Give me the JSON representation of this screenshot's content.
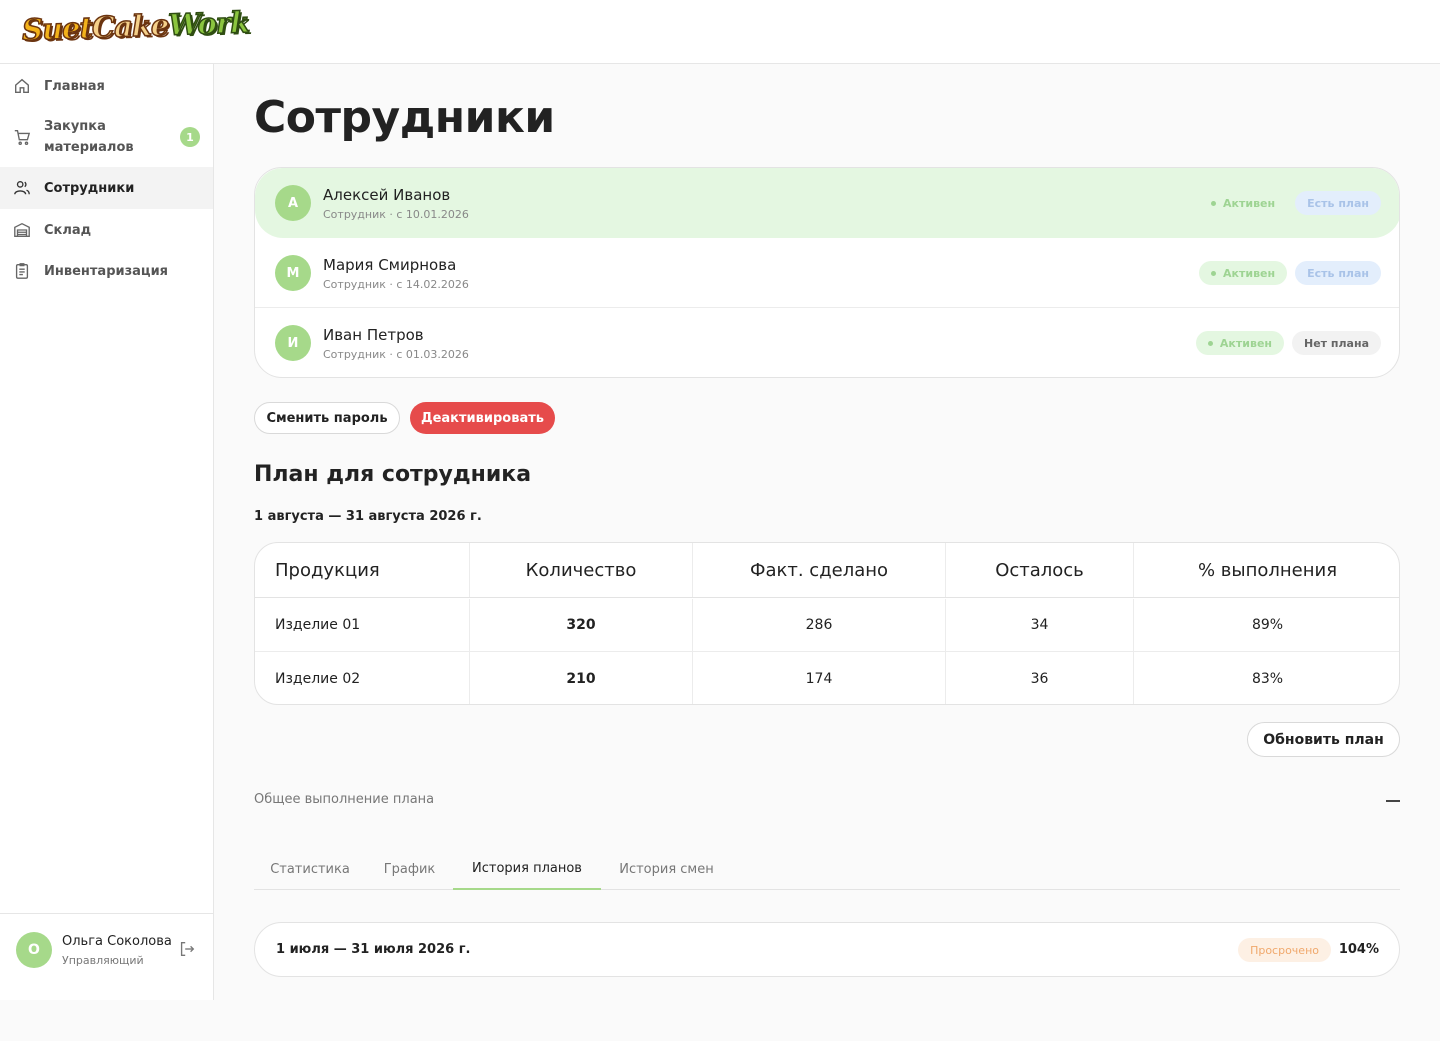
{
  "brand": {
    "logo_parts": [
      "Suet",
      "Cake",
      "Work"
    ]
  },
  "sidebar": {
    "items": [
      {
        "label": "Главная",
        "icon": "home-icon"
      },
      {
        "label": "Закупка материалов",
        "label_lines": [
          "Закупка",
          "материалов"
        ],
        "icon": "cart-icon",
        "badge": "1"
      },
      {
        "label": "Сотрудники",
        "icon": "users-icon",
        "active": true
      },
      {
        "label": "Склад",
        "icon": "warehouse-icon"
      },
      {
        "label": "Инвентаризация",
        "icon": "clipboard-icon"
      }
    ],
    "user": {
      "initial": "О",
      "name": "Ольга Соколова",
      "role": "Управляющий",
      "logout_icon": "logout-icon"
    }
  },
  "page": {
    "title": "Сотрудники"
  },
  "employees": [
    {
      "initial": "А",
      "name": "Алексей Иванов",
      "subtitle": "Сотрудник · с 10.01.2026",
      "status": "Активен",
      "plan": "Есть план",
      "selected": true
    },
    {
      "initial": "М",
      "name": "Мария Смирнова",
      "subtitle": "Сотрудник · с 14.02.2026",
      "status": "Активен",
      "plan": "Есть план"
    },
    {
      "initial": "И",
      "name": "Иван Петров",
      "subtitle": "Сотрудник · с 01.03.2026",
      "status": "Активен",
      "plan": "Нет плана"
    }
  ],
  "actions": {
    "change_password": "Сменить пароль",
    "deactivate": "Деактивировать"
  },
  "plan": {
    "title": "План для сотрудника",
    "period": "1 августа — 31 августа 2026 г.",
    "columns": [
      "Продукция",
      "Количество",
      "Факт. сделано",
      "Осталось",
      "% выполнения"
    ],
    "rows": [
      [
        "Изделие 01",
        "320",
        "286",
        "34",
        "89%"
      ],
      [
        "Изделие 02",
        "210",
        "174",
        "36",
        "83%"
      ]
    ],
    "update_button": "Обновить план"
  },
  "overall": {
    "label": "Общее выполнение плана",
    "toggle_icon": "minus-icon"
  },
  "tabs": [
    {
      "label": "Статистика"
    },
    {
      "label": "График"
    },
    {
      "label": "История планов",
      "active": true
    },
    {
      "label": "История смен"
    }
  ],
  "history": [
    {
      "period": "1 июля — 31 июля 2026 г.",
      "status": "Просрочено",
      "percent": "104%"
    }
  ],
  "colors": {
    "accent": "#a6d98a",
    "danger": "#e64b4b",
    "selected_row": "#e4f7e1"
  }
}
